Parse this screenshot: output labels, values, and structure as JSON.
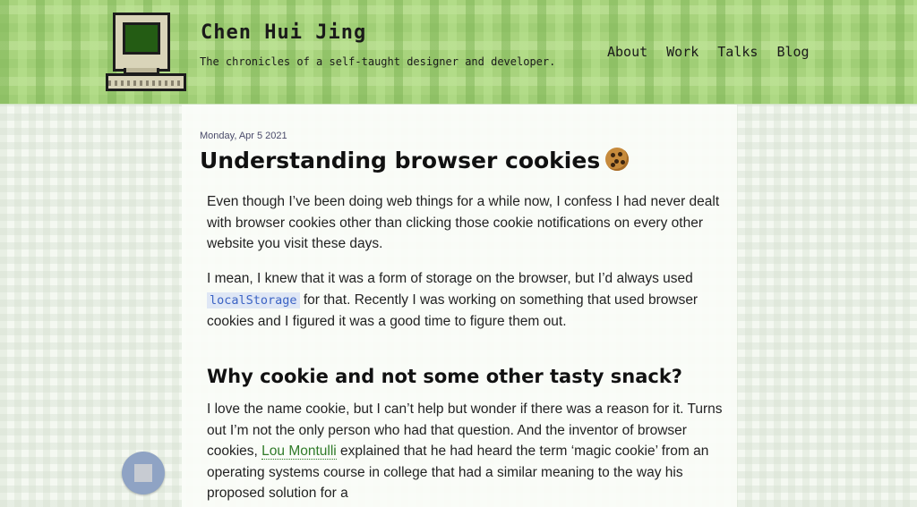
{
  "header": {
    "site_title": "Chen Hui Jing",
    "tagline": "The chronicles of a self-taught designer and developer.",
    "logo_icon": "retro-computer-icon",
    "nav": [
      {
        "label": "About"
      },
      {
        "label": "Work"
      },
      {
        "label": "Talks"
      },
      {
        "label": "Blog"
      }
    ]
  },
  "article": {
    "date": "Monday, Apr 5 2021",
    "title": "Understanding browser cookies",
    "title_icon": "cookie-emoji",
    "paragraphs": [
      {
        "text": "Even though I’ve been doing web things for a while now, I confess I had never dealt with browser cookies other than clicking those cookie notifications on every other website you visit these days."
      },
      {
        "before": "I mean, I knew that it was a form of storage on the browser, but I’d always used ",
        "code": "localStorage",
        "after": " for that. Recently I was working on something that used browser cookies and I figured it was a good time to figure them out."
      },
      {
        "before": "I love the name cookie, but I can’t help but wonder if there was a reason for it. Turns out I’m not the only person who had that question. And the inventor of browser cookies, ",
        "link": "Lou Montulli",
        "after": " explained that he had heard the term ‘magic cookie’ from an operating systems course in college that had a similar meaning to the way his proposed solution for a"
      }
    ],
    "heading": "Why cookie and not some other tasty snack?"
  },
  "fab": {
    "icon": "stop-square-icon"
  },
  "colors": {
    "header_green": "#a8d37d",
    "link_green": "#2f7a28",
    "code_blue": "#3b63c4"
  }
}
